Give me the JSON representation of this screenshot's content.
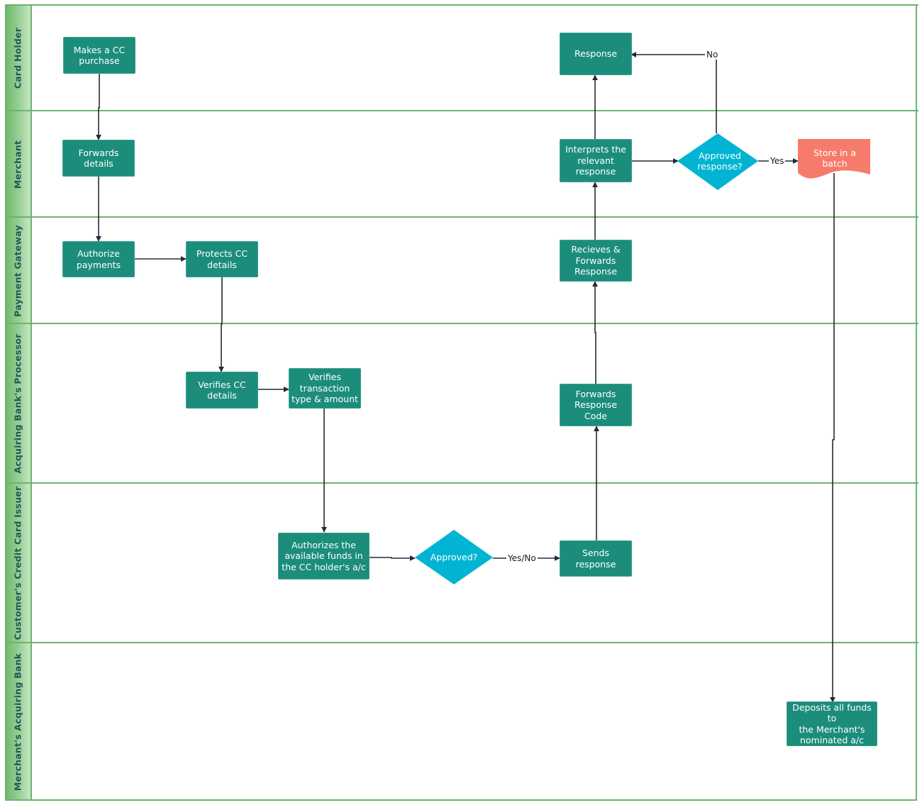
{
  "diagram": {
    "type": "swimlane-flowchart",
    "colors": {
      "lane_border": "#6cb46c",
      "lane_header_text": "#1d5a55",
      "process_fill": "#1c8d7b",
      "decision_fill": "#00b4d2",
      "document_fill": "#f77b6c",
      "connector": "#232a3a"
    },
    "lanes": [
      {
        "id": "card-holder",
        "title": "Card Holder"
      },
      {
        "id": "merchant",
        "title": "Merchant"
      },
      {
        "id": "payment-gateway",
        "title": "Payment Gateway"
      },
      {
        "id": "acquiring-processor",
        "title": "Acquiring Bank's Processor"
      },
      {
        "id": "card-issuer",
        "title": "Customer's Credit Card Issuer"
      },
      {
        "id": "acquiring-bank",
        "title": "Merchant's Acquiring Bank"
      }
    ],
    "nodes": {
      "makes_purchase": {
        "lane": "card-holder",
        "shape": "process",
        "text": "Makes a CC\npurchase"
      },
      "response": {
        "lane": "card-holder",
        "shape": "process",
        "text": "Response"
      },
      "forwards_details": {
        "lane": "merchant",
        "shape": "process",
        "text": "Forwards\ndetails"
      },
      "interprets": {
        "lane": "merchant",
        "shape": "process",
        "text": "Interprets the\nrelevant\nresponse"
      },
      "approved_response": {
        "lane": "merchant",
        "shape": "decision",
        "text": "Approved\nresponse?"
      },
      "store_batch": {
        "lane": "merchant",
        "shape": "document",
        "text": "Store in  a\nbatch"
      },
      "authorize_payments": {
        "lane": "payment-gateway",
        "shape": "process",
        "text": "Authorize\npayments"
      },
      "protects_cc": {
        "lane": "payment-gateway",
        "shape": "process",
        "text": "Protects CC\ndetails"
      },
      "receives_forwards": {
        "lane": "payment-gateway",
        "shape": "process",
        "text": "Recieves &\nForwards\nResponse"
      },
      "verifies_cc": {
        "lane": "acquiring-processor",
        "shape": "process",
        "text": "Verifies CC\ndetails"
      },
      "verifies_txn": {
        "lane": "acquiring-processor",
        "shape": "process",
        "text": "Verifies\ntransaction\ntype & amount"
      },
      "forwards_code": {
        "lane": "acquiring-processor",
        "shape": "process",
        "text": "Forwards\nResponse\nCode"
      },
      "authorizes_funds": {
        "lane": "card-issuer",
        "shape": "process",
        "text": "Authorizes the\navailable funds in\nthe CC holder's a/c"
      },
      "approved": {
        "lane": "card-issuer",
        "shape": "decision",
        "text": "Approved?"
      },
      "sends_response": {
        "lane": "card-issuer",
        "shape": "process",
        "text": "Sends\nresponse"
      },
      "deposits": {
        "lane": "acquiring-bank",
        "shape": "process",
        "text": "Deposits all funds to\nthe Merchant's\nnominated a/c"
      }
    },
    "edges": [
      {
        "from": "makes_purchase",
        "to": "forwards_details",
        "label": ""
      },
      {
        "from": "forwards_details",
        "to": "authorize_payments",
        "label": ""
      },
      {
        "from": "authorize_payments",
        "to": "protects_cc",
        "label": ""
      },
      {
        "from": "protects_cc",
        "to": "verifies_cc",
        "label": ""
      },
      {
        "from": "verifies_cc",
        "to": "verifies_txn",
        "label": ""
      },
      {
        "from": "verifies_txn",
        "to": "authorizes_funds",
        "label": ""
      },
      {
        "from": "authorizes_funds",
        "to": "approved",
        "label": ""
      },
      {
        "from": "approved",
        "to": "sends_response",
        "label": "Yes/No"
      },
      {
        "from": "sends_response",
        "to": "forwards_code",
        "label": ""
      },
      {
        "from": "forwards_code",
        "to": "receives_forwards",
        "label": ""
      },
      {
        "from": "receives_forwards",
        "to": "interprets",
        "label": ""
      },
      {
        "from": "interprets",
        "to": "response",
        "label": ""
      },
      {
        "from": "interprets",
        "to": "approved_response",
        "label": ""
      },
      {
        "from": "approved_response",
        "to": "response",
        "label": "No"
      },
      {
        "from": "approved_response",
        "to": "store_batch",
        "label": "Yes"
      },
      {
        "from": "store_batch",
        "to": "deposits",
        "label": ""
      }
    ],
    "edge_labels": {
      "yes_no": "Yes/No",
      "no": "No",
      "yes": "Yes"
    }
  }
}
